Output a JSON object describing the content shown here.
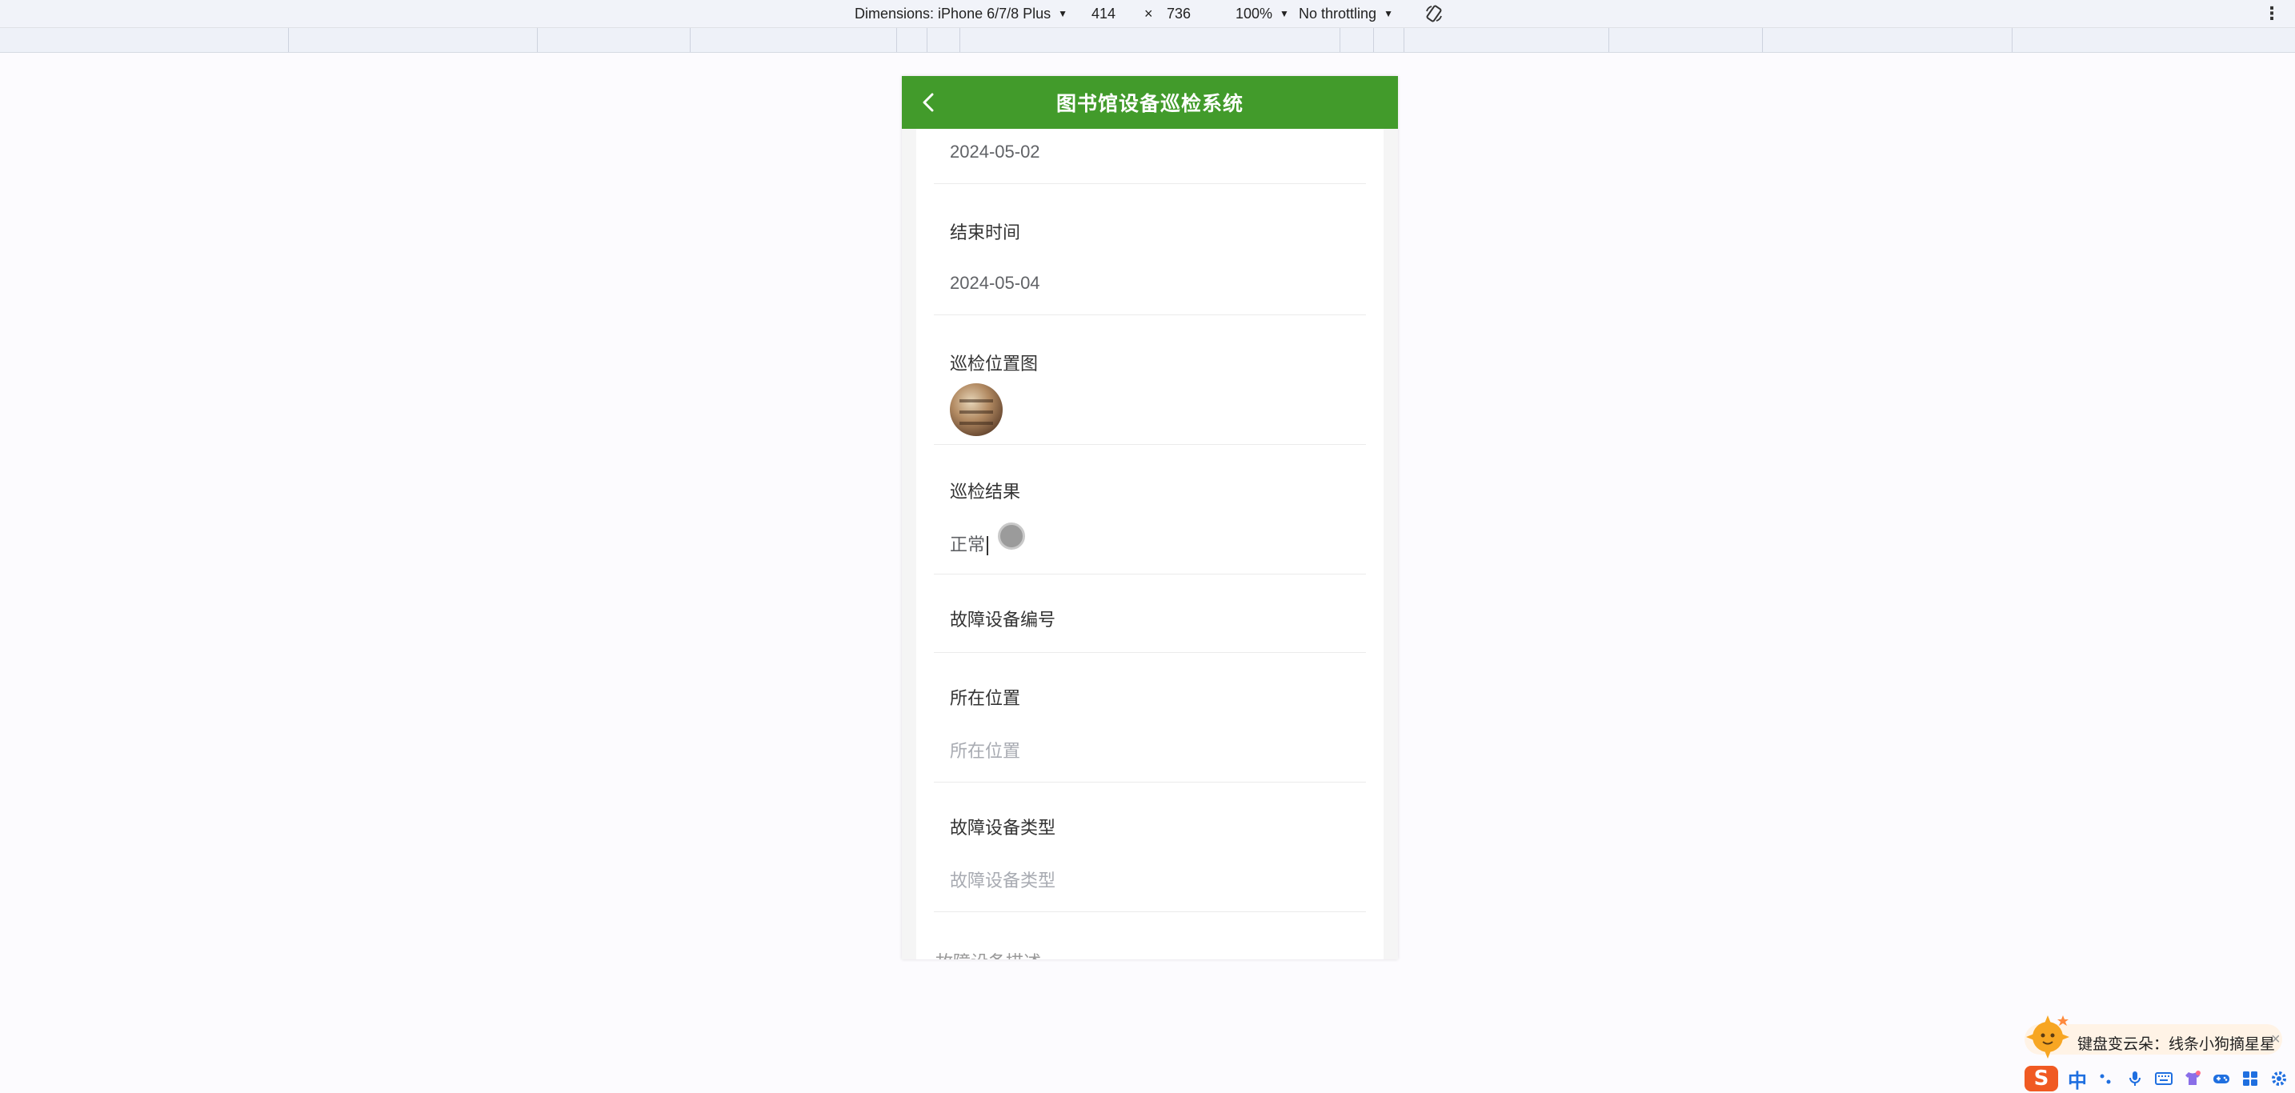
{
  "devtools": {
    "dimensions_label": "Dimensions: iPhone 6/7/8 Plus",
    "width_value": "414",
    "times": "×",
    "height_value": "736",
    "zoom": "100%",
    "throttling": "No throttling"
  },
  "app": {
    "title": "图书馆设备巡检系统",
    "accent_color": "#429b2b"
  },
  "form": {
    "start_date_value": "2024-05-02",
    "end_time": {
      "label": "结束时间",
      "value": "2024-05-04"
    },
    "location_image": {
      "label": "巡检位置图"
    },
    "result": {
      "label": "巡检结果",
      "value": "正常"
    },
    "fault_device_no": {
      "label": "故障设备编号"
    },
    "location": {
      "label": "所在位置",
      "placeholder": "所在位置"
    },
    "fault_device_type": {
      "label": "故障设备类型",
      "placeholder": "故障设备类型"
    },
    "next_label_partial": "故障设备描述"
  },
  "ime": {
    "tip": "键盘变云朵：线条小狗摘星星",
    "close": "×",
    "logo": "S",
    "mode": "中"
  }
}
